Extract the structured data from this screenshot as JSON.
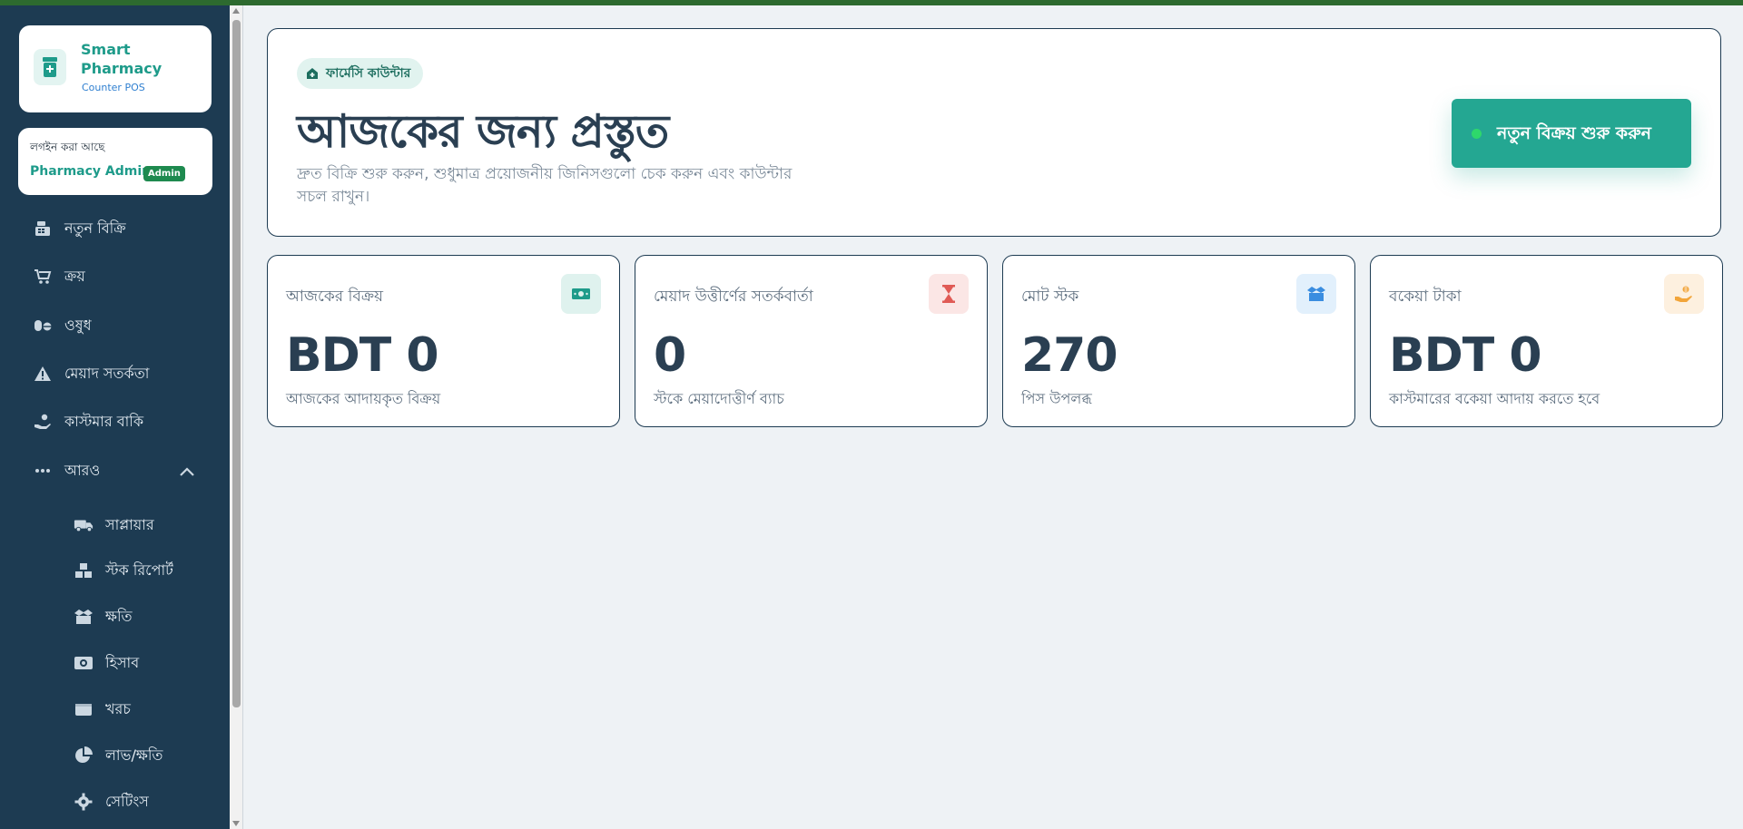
{
  "brand": {
    "name": "Smart Pharmacy",
    "subtitle": "Counter POS"
  },
  "user": {
    "label": "লগইন করা আছে",
    "name": "Pharmacy Admin",
    "role": "Admin"
  },
  "nav": {
    "items": [
      {
        "label": "নতুন বিক্রি",
        "icon": "cash-register-icon"
      },
      {
        "label": "ক্রয়",
        "icon": "cart-icon"
      },
      {
        "label": "ওষুধ",
        "icon": "pills-icon"
      },
      {
        "label": "মেয়াদ সতর্কতা",
        "icon": "warning-icon"
      },
      {
        "label": "কাস্টমার বাকি",
        "icon": "hand-money-icon"
      },
      {
        "label": "আরও",
        "icon": "more-dots-icon"
      }
    ],
    "sub_items": [
      {
        "label": "সাপ্লায়ার",
        "icon": "truck-icon"
      },
      {
        "label": "স্টক রিপোর্ট",
        "icon": "boxes-icon"
      },
      {
        "label": "ক্ষতি",
        "icon": "box-open-icon"
      },
      {
        "label": "হিসাব",
        "icon": "money-icon"
      },
      {
        "label": "খরচ",
        "icon": "wallet-icon"
      },
      {
        "label": "লাভ/ক্ষতি",
        "icon": "pie-chart-icon"
      },
      {
        "label": "সেটিংস",
        "icon": "gear-icon"
      }
    ]
  },
  "hero": {
    "badge": "ফার্মেসি কাউন্টার",
    "title": "আজকের জন্য প্রস্তুত",
    "description": "দ্রুত বিক্রি শুরু করুন, শুধুমাত্র প্রয়োজনীয় জিনিসগুলো চেক করুন এবং কাউন্টার সচল রাখুন।",
    "button": "নতুন বিক্রয় শুরু করুন"
  },
  "stats": [
    {
      "label": "আজকের বিক্রয়",
      "value": "BDT 0",
      "sub": "আজকের আদায়কৃত বিক্রয়",
      "icon": "money-bill-icon",
      "color": "#1e9b8a",
      "bg": "#dff2ee"
    },
    {
      "label": "মেয়াদ উত্তীর্ণের সতর্কবার্তা",
      "value": "0",
      "sub": "স্টকে মেয়াদোত্তীর্ণ ব্যাচ",
      "icon": "hourglass-icon",
      "color": "#e05a55",
      "bg": "#fbe6e5"
    },
    {
      "label": "মোট স্টক",
      "value": "270",
      "sub": "পিস উপলব্ধ",
      "icon": "box-icon",
      "color": "#3a8de0",
      "bg": "#e2f0fc"
    },
    {
      "label": "বকেয়া টাকা",
      "value": "BDT 0",
      "sub": "কাস্টমারের বকেয়া আদায় করতে হবে",
      "icon": "hand-coin-icon",
      "color": "#f2a53a",
      "bg": "#fdf0df"
    }
  ]
}
